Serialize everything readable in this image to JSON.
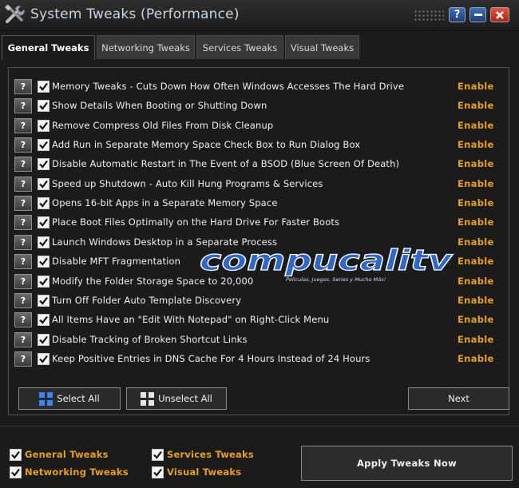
{
  "window": {
    "title": "System Tweaks (Performance)",
    "help_label": "?"
  },
  "tabs": [
    {
      "label": "General Tweaks",
      "active": true
    },
    {
      "label": "Networking Tweaks",
      "active": false
    },
    {
      "label": "Services Tweaks",
      "active": false
    },
    {
      "label": "Visual Tweaks",
      "active": false
    }
  ],
  "tweaks": [
    {
      "help": "?",
      "checked": true,
      "label": "Memory Tweaks - Cuts Down How Often Windows Accesses The Hard Drive",
      "status": "Enable"
    },
    {
      "help": "?",
      "checked": true,
      "label": "Show Details When Booting or Shutting Down",
      "status": "Enable"
    },
    {
      "help": "?",
      "checked": true,
      "label": "Remove Compress Old Files From Disk Cleanup",
      "status": "Enable"
    },
    {
      "help": "?",
      "checked": true,
      "label": "Add Run in Separate Memory Space Check Box to Run Dialog Box",
      "status": "Enable"
    },
    {
      "help": "?",
      "checked": true,
      "label": "Disable Automatic Restart in The Event of a BSOD (Blue Screen Of Death)",
      "status": "Enable"
    },
    {
      "help": "?",
      "checked": true,
      "label": "Speed up Shutdown - Auto Kill Hung Programs & Services",
      "status": "Enable"
    },
    {
      "help": "?",
      "checked": true,
      "label": "Opens 16-bit Apps in a Separate Memory Space",
      "status": "Enable"
    },
    {
      "help": "?",
      "checked": true,
      "label": "Place Boot Files Optimally on the Hard Drive For Faster Boots",
      "status": "Enable"
    },
    {
      "help": "?",
      "checked": true,
      "label": "Launch Windows Desktop in a Separate Process",
      "status": "Enable"
    },
    {
      "help": "?",
      "checked": true,
      "label": "Disable MFT Fragmentation",
      "status": "Enable"
    },
    {
      "help": "?",
      "checked": true,
      "label": "Modify the Folder Storage Space to 20,000",
      "status": "Enable"
    },
    {
      "help": "?",
      "checked": true,
      "label": "Turn Off Folder Auto Template Discovery",
      "status": "Enable"
    },
    {
      "help": "?",
      "checked": true,
      "label": "All Items Have an \"Edit With Notepad\" on Right-Click Menu",
      "status": "Enable"
    },
    {
      "help": "?",
      "checked": true,
      "label": "Disable Tracking of Broken Shortcut Links",
      "status": "Enable"
    },
    {
      "help": "?",
      "checked": true,
      "label": "Keep Positive Entries in DNS Cache For 4 Hours Instead of 24 Hours",
      "status": "Enable"
    }
  ],
  "buttons": {
    "select_all": "Select All",
    "unselect_all": "Unselect All",
    "next": "Next",
    "apply": "Apply Tweaks Now"
  },
  "footer_checks": [
    {
      "label": "General Tweaks",
      "checked": true
    },
    {
      "label": "Networking Tweaks",
      "checked": true
    },
    {
      "label": "Services Tweaks",
      "checked": true
    },
    {
      "label": "Visual Tweaks",
      "checked": true
    }
  ],
  "watermark": {
    "brand": "compucalitv",
    "tagline": "Peliculas, Juegos, Series y Mucho Más!"
  },
  "colors": {
    "status": "#e8a020",
    "background": "#1b1b1b",
    "watermark": "#2f67c9"
  }
}
